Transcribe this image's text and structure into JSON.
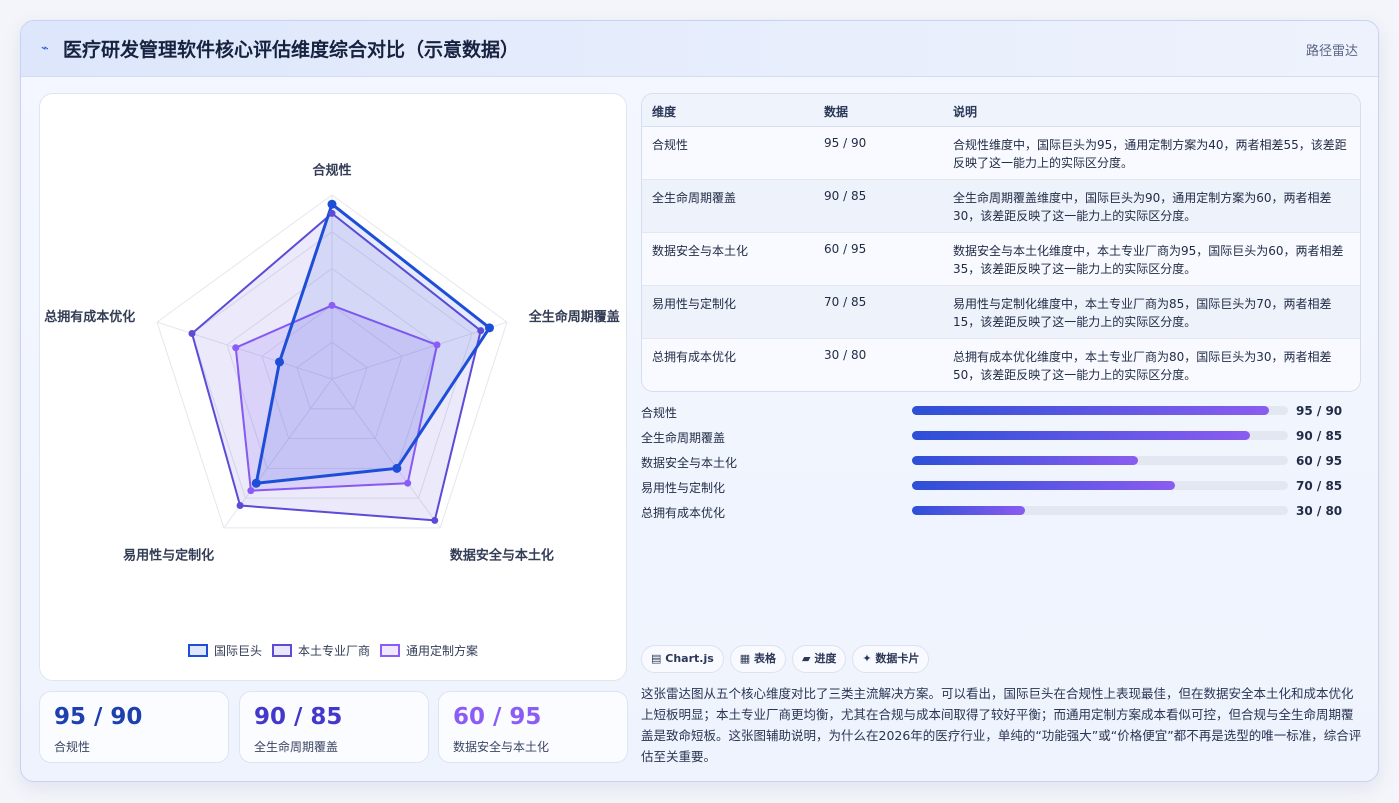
{
  "header": {
    "icon": "pulse-icon",
    "title": "医疗研发管理软件核心评估维度综合对比（示意数据）",
    "tag": "路径雷达"
  },
  "chart_data": {
    "type": "radar",
    "axes": [
      "合规性",
      "全生命周期覆盖",
      "数据安全与本土化",
      "易用性与定制化",
      "总拥有成本优化"
    ],
    "range": [
      0,
      100
    ],
    "grid": true,
    "legend_position": "bottom",
    "series": [
      {
        "name": "国际巨头",
        "values": [
          95,
          90,
          60,
          70,
          30
        ],
        "color": "#1d4ed8"
      },
      {
        "name": "本土专业厂商",
        "values": [
          90,
          85,
          95,
          85,
          80
        ],
        "color": "#5b4bd6"
      },
      {
        "name": "通用定制方案",
        "values": [
          40,
          60,
          70,
          75,
          55
        ],
        "color": "#8b5cf6"
      }
    ]
  },
  "stats": [
    {
      "value": "95 / 90",
      "label": "合规性",
      "color": "#1e40af"
    },
    {
      "value": "90 / 85",
      "label": "全生命周期覆盖",
      "color": "#4338ca"
    },
    {
      "value": "60 / 95",
      "label": "数据安全与本土化",
      "color": "#8b5cf6"
    }
  ],
  "table": {
    "headers": [
      "维度",
      "数据",
      "说明"
    ],
    "rows": [
      {
        "dim": "合规性",
        "data": "95 / 90",
        "desc": "合规性维度中，国际巨头为95，通用定制方案为40，两者相差55，该差距反映了这一能力上的实际区分度。"
      },
      {
        "dim": "全生命周期覆盖",
        "data": "90 / 85",
        "desc": "全生命周期覆盖维度中，国际巨头为90，通用定制方案为60，两者相差30，该差距反映了这一能力上的实际区分度。"
      },
      {
        "dim": "数据安全与本土化",
        "data": "60 / 95",
        "desc": "数据安全与本土化维度中，本土专业厂商为95，国际巨头为60，两者相差35，该差距反映了这一能力上的实际区分度。"
      },
      {
        "dim": "易用性与定制化",
        "data": "70 / 85",
        "desc": "易用性与定制化维度中，本土专业厂商为85，国际巨头为70，两者相差15，该差距反映了这一能力上的实际区分度。"
      },
      {
        "dim": "总拥有成本优化",
        "data": "30 / 80",
        "desc": "总拥有成本优化维度中，本土专业厂商为80，国际巨头为30，两者相差50，该差距反映了这一能力上的实际区分度。"
      }
    ]
  },
  "progress": [
    {
      "label": "合规性",
      "fill_percent": 95,
      "value": "95 / 90"
    },
    {
      "label": "全生命周期覆盖",
      "fill_percent": 90,
      "value": "90 / 85"
    },
    {
      "label": "数据安全与本土化",
      "fill_percent": 60,
      "value": "60 / 95"
    },
    {
      "label": "易用性与定制化",
      "fill_percent": 70,
      "value": "70 / 85"
    },
    {
      "label": "总拥有成本优化",
      "fill_percent": 30,
      "value": "30 / 80"
    }
  ],
  "chips": [
    {
      "icon": "chart-icon",
      "glyph": "▤",
      "label": "Chart.js"
    },
    {
      "icon": "table-icon",
      "glyph": "▦",
      "label": "表格"
    },
    {
      "icon": "progress-icon",
      "glyph": "▰",
      "label": "进度"
    },
    {
      "icon": "card-icon",
      "glyph": "✦",
      "label": "数据卡片"
    }
  ],
  "summary": "这张雷达图从五个核心维度对比了三类主流解决方案。可以看出，国际巨头在合规性上表现最佳，但在数据安全本土化和成本优化上短板明显；本土专业厂商更均衡，尤其在合规与成本间取得了较好平衡；而通用定制方案成本看似可控，但合规与全生命周期覆盖是致命短板。这张图辅助说明，为什么在2026年的医疗行业，单纯的“功能强大”或“价格便宜”都不再是选型的唯一标准，综合评估至关重要。"
}
